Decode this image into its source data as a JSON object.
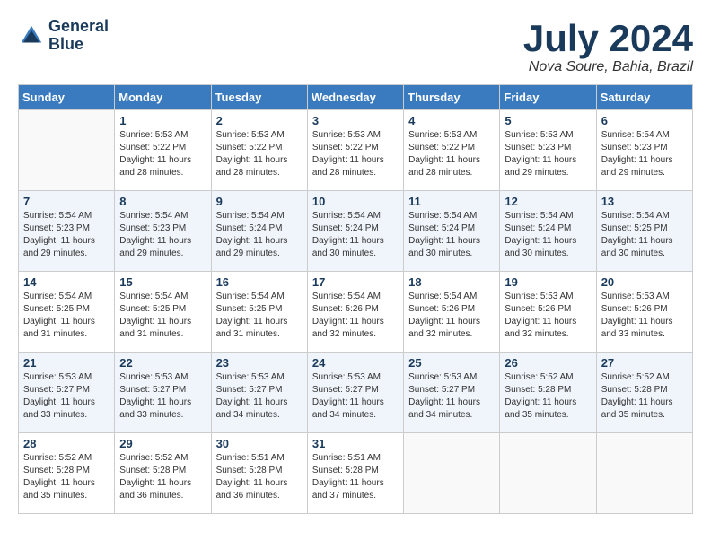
{
  "header": {
    "logo_line1": "General",
    "logo_line2": "Blue",
    "month": "July 2024",
    "location": "Nova Soure, Bahia, Brazil"
  },
  "days_of_week": [
    "Sunday",
    "Monday",
    "Tuesday",
    "Wednesday",
    "Thursday",
    "Friday",
    "Saturday"
  ],
  "weeks": [
    [
      {
        "day": "",
        "empty": true
      },
      {
        "day": "1",
        "sunrise": "Sunrise: 5:53 AM",
        "sunset": "Sunset: 5:22 PM",
        "daylight": "Daylight: 11 hours and 28 minutes."
      },
      {
        "day": "2",
        "sunrise": "Sunrise: 5:53 AM",
        "sunset": "Sunset: 5:22 PM",
        "daylight": "Daylight: 11 hours and 28 minutes."
      },
      {
        "day": "3",
        "sunrise": "Sunrise: 5:53 AM",
        "sunset": "Sunset: 5:22 PM",
        "daylight": "Daylight: 11 hours and 28 minutes."
      },
      {
        "day": "4",
        "sunrise": "Sunrise: 5:53 AM",
        "sunset": "Sunset: 5:22 PM",
        "daylight": "Daylight: 11 hours and 28 minutes."
      },
      {
        "day": "5",
        "sunrise": "Sunrise: 5:53 AM",
        "sunset": "Sunset: 5:23 PM",
        "daylight": "Daylight: 11 hours and 29 minutes."
      },
      {
        "day": "6",
        "sunrise": "Sunrise: 5:54 AM",
        "sunset": "Sunset: 5:23 PM",
        "daylight": "Daylight: 11 hours and 29 minutes."
      }
    ],
    [
      {
        "day": "7",
        "sunrise": "Sunrise: 5:54 AM",
        "sunset": "Sunset: 5:23 PM",
        "daylight": "Daylight: 11 hours and 29 minutes."
      },
      {
        "day": "8",
        "sunrise": "Sunrise: 5:54 AM",
        "sunset": "Sunset: 5:23 PM",
        "daylight": "Daylight: 11 hours and 29 minutes."
      },
      {
        "day": "9",
        "sunrise": "Sunrise: 5:54 AM",
        "sunset": "Sunset: 5:24 PM",
        "daylight": "Daylight: 11 hours and 29 minutes."
      },
      {
        "day": "10",
        "sunrise": "Sunrise: 5:54 AM",
        "sunset": "Sunset: 5:24 PM",
        "daylight": "Daylight: 11 hours and 30 minutes."
      },
      {
        "day": "11",
        "sunrise": "Sunrise: 5:54 AM",
        "sunset": "Sunset: 5:24 PM",
        "daylight": "Daylight: 11 hours and 30 minutes."
      },
      {
        "day": "12",
        "sunrise": "Sunrise: 5:54 AM",
        "sunset": "Sunset: 5:24 PM",
        "daylight": "Daylight: 11 hours and 30 minutes."
      },
      {
        "day": "13",
        "sunrise": "Sunrise: 5:54 AM",
        "sunset": "Sunset: 5:25 PM",
        "daylight": "Daylight: 11 hours and 30 minutes."
      }
    ],
    [
      {
        "day": "14",
        "sunrise": "Sunrise: 5:54 AM",
        "sunset": "Sunset: 5:25 PM",
        "daylight": "Daylight: 11 hours and 31 minutes."
      },
      {
        "day": "15",
        "sunrise": "Sunrise: 5:54 AM",
        "sunset": "Sunset: 5:25 PM",
        "daylight": "Daylight: 11 hours and 31 minutes."
      },
      {
        "day": "16",
        "sunrise": "Sunrise: 5:54 AM",
        "sunset": "Sunset: 5:25 PM",
        "daylight": "Daylight: 11 hours and 31 minutes."
      },
      {
        "day": "17",
        "sunrise": "Sunrise: 5:54 AM",
        "sunset": "Sunset: 5:26 PM",
        "daylight": "Daylight: 11 hours and 32 minutes."
      },
      {
        "day": "18",
        "sunrise": "Sunrise: 5:54 AM",
        "sunset": "Sunset: 5:26 PM",
        "daylight": "Daylight: 11 hours and 32 minutes."
      },
      {
        "day": "19",
        "sunrise": "Sunrise: 5:53 AM",
        "sunset": "Sunset: 5:26 PM",
        "daylight": "Daylight: 11 hours and 32 minutes."
      },
      {
        "day": "20",
        "sunrise": "Sunrise: 5:53 AM",
        "sunset": "Sunset: 5:26 PM",
        "daylight": "Daylight: 11 hours and 33 minutes."
      }
    ],
    [
      {
        "day": "21",
        "sunrise": "Sunrise: 5:53 AM",
        "sunset": "Sunset: 5:27 PM",
        "daylight": "Daylight: 11 hours and 33 minutes."
      },
      {
        "day": "22",
        "sunrise": "Sunrise: 5:53 AM",
        "sunset": "Sunset: 5:27 PM",
        "daylight": "Daylight: 11 hours and 33 minutes."
      },
      {
        "day": "23",
        "sunrise": "Sunrise: 5:53 AM",
        "sunset": "Sunset: 5:27 PM",
        "daylight": "Daylight: 11 hours and 34 minutes."
      },
      {
        "day": "24",
        "sunrise": "Sunrise: 5:53 AM",
        "sunset": "Sunset: 5:27 PM",
        "daylight": "Daylight: 11 hours and 34 minutes."
      },
      {
        "day": "25",
        "sunrise": "Sunrise: 5:53 AM",
        "sunset": "Sunset: 5:27 PM",
        "daylight": "Daylight: 11 hours and 34 minutes."
      },
      {
        "day": "26",
        "sunrise": "Sunrise: 5:52 AM",
        "sunset": "Sunset: 5:28 PM",
        "daylight": "Daylight: 11 hours and 35 minutes."
      },
      {
        "day": "27",
        "sunrise": "Sunrise: 5:52 AM",
        "sunset": "Sunset: 5:28 PM",
        "daylight": "Daylight: 11 hours and 35 minutes."
      }
    ],
    [
      {
        "day": "28",
        "sunrise": "Sunrise: 5:52 AM",
        "sunset": "Sunset: 5:28 PM",
        "daylight": "Daylight: 11 hours and 35 minutes."
      },
      {
        "day": "29",
        "sunrise": "Sunrise: 5:52 AM",
        "sunset": "Sunset: 5:28 PM",
        "daylight": "Daylight: 11 hours and 36 minutes."
      },
      {
        "day": "30",
        "sunrise": "Sunrise: 5:51 AM",
        "sunset": "Sunset: 5:28 PM",
        "daylight": "Daylight: 11 hours and 36 minutes."
      },
      {
        "day": "31",
        "sunrise": "Sunrise: 5:51 AM",
        "sunset": "Sunset: 5:28 PM",
        "daylight": "Daylight: 11 hours and 37 minutes."
      },
      {
        "day": "",
        "empty": true
      },
      {
        "day": "",
        "empty": true
      },
      {
        "day": "",
        "empty": true
      }
    ]
  ]
}
